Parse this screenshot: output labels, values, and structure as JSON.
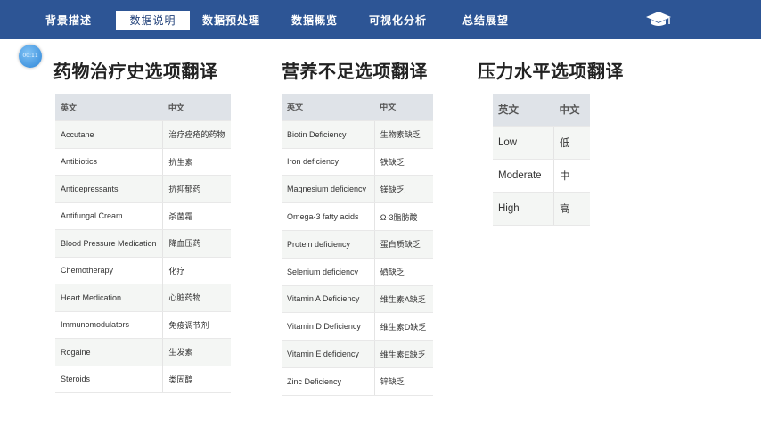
{
  "nav": {
    "items": [
      {
        "label": "背景描述"
      },
      {
        "label": "数据说明"
      },
      {
        "label": "数据预处理"
      },
      {
        "label": "数据概览"
      },
      {
        "label": "可视化分析"
      },
      {
        "label": "总结展望"
      }
    ]
  },
  "badge": {
    "text": "00:11"
  },
  "sections": [
    {
      "title": "药物治疗史选项翻译",
      "headers": [
        "英文",
        "中文"
      ],
      "rows": [
        [
          "Accutane",
          "治疗痤疮的药物"
        ],
        [
          "Antibiotics",
          "抗生素"
        ],
        [
          "Antidepressants",
          "抗抑郁药"
        ],
        [
          "Antifungal Cream",
          "杀菌霜"
        ],
        [
          "Blood Pressure Medication",
          "降血压药"
        ],
        [
          "Chemotherapy",
          "化疗"
        ],
        [
          "Heart Medication",
          "心脏药物"
        ],
        [
          "Immunomodulators",
          "免疫调节剂"
        ],
        [
          "Rogaine",
          "生发素"
        ],
        [
          "Steroids",
          "类固醇"
        ]
      ]
    },
    {
      "title": "营养不足选项翻译",
      "headers": [
        "英文",
        "中文"
      ],
      "rows": [
        [
          "Biotin Deficiency",
          "生物素缺乏"
        ],
        [
          "Iron deficiency",
          "铁缺乏"
        ],
        [
          "Magnesium deficiency",
          "镁缺乏"
        ],
        [
          "Omega-3 fatty acids",
          "Ω-3脂肪酸"
        ],
        [
          "Protein deficiency",
          "蛋白质缺乏"
        ],
        [
          "Selenium deficiency",
          "硒缺乏"
        ],
        [
          "Vitamin A Deficiency",
          "维生素A缺乏"
        ],
        [
          "Vitamin D Deficiency",
          "维生素D缺乏"
        ],
        [
          "Vitamin E deficiency",
          "维生素E缺乏"
        ],
        [
          "Zinc Deficiency",
          "锌缺乏"
        ]
      ]
    },
    {
      "title": "压力水平选项翻译",
      "headers": [
        "英文",
        "中文"
      ],
      "rows": [
        [
          "Low",
          "低"
        ],
        [
          "Moderate",
          "中"
        ],
        [
          "High",
          "高"
        ]
      ]
    }
  ],
  "chart_data": [
    {
      "type": "table",
      "title": "药物治疗史选项翻译",
      "columns": [
        "英文",
        "中文"
      ],
      "rows": [
        [
          "Accutane",
          "治疗痤疮的药物"
        ],
        [
          "Antibiotics",
          "抗生素"
        ],
        [
          "Antidepressants",
          "抗抑郁药"
        ],
        [
          "Antifungal Cream",
          "杀菌霜"
        ],
        [
          "Blood Pressure Medication",
          "降血压药"
        ],
        [
          "Chemotherapy",
          "化疗"
        ],
        [
          "Heart Medication",
          "心脏药物"
        ],
        [
          "Immunomodulators",
          "免疫调节剂"
        ],
        [
          "Rogaine",
          "生发素"
        ],
        [
          "Steroids",
          "类固醇"
        ]
      ]
    },
    {
      "type": "table",
      "title": "营养不足选项翻译",
      "columns": [
        "英文",
        "中文"
      ],
      "rows": [
        [
          "Biotin Deficiency",
          "生物素缺乏"
        ],
        [
          "Iron deficiency",
          "铁缺乏"
        ],
        [
          "Magnesium deficiency",
          "镁缺乏"
        ],
        [
          "Omega-3 fatty acids",
          "Ω-3脂肪酸"
        ],
        [
          "Protein deficiency",
          "蛋白质缺乏"
        ],
        [
          "Selenium deficiency",
          "硒缺乏"
        ],
        [
          "Vitamin A Deficiency",
          "维生素A缺乏"
        ],
        [
          "Vitamin D Deficiency",
          "维生素D缺乏"
        ],
        [
          "Vitamin E deficiency",
          "维生素E缺乏"
        ],
        [
          "Zinc Deficiency",
          "锌缺乏"
        ]
      ]
    },
    {
      "type": "table",
      "title": "压力水平选项翻译",
      "columns": [
        "英文",
        "中文"
      ],
      "rows": [
        [
          "Low",
          "低"
        ],
        [
          "Moderate",
          "中"
        ],
        [
          "High",
          "高"
        ]
      ]
    }
  ],
  "colors": {
    "topbar": "#2d5595",
    "header_bg": "#dfe3e8",
    "row_alt": "#f4f6f4"
  },
  "icons": {
    "logo": "graduation-cap-icon"
  }
}
